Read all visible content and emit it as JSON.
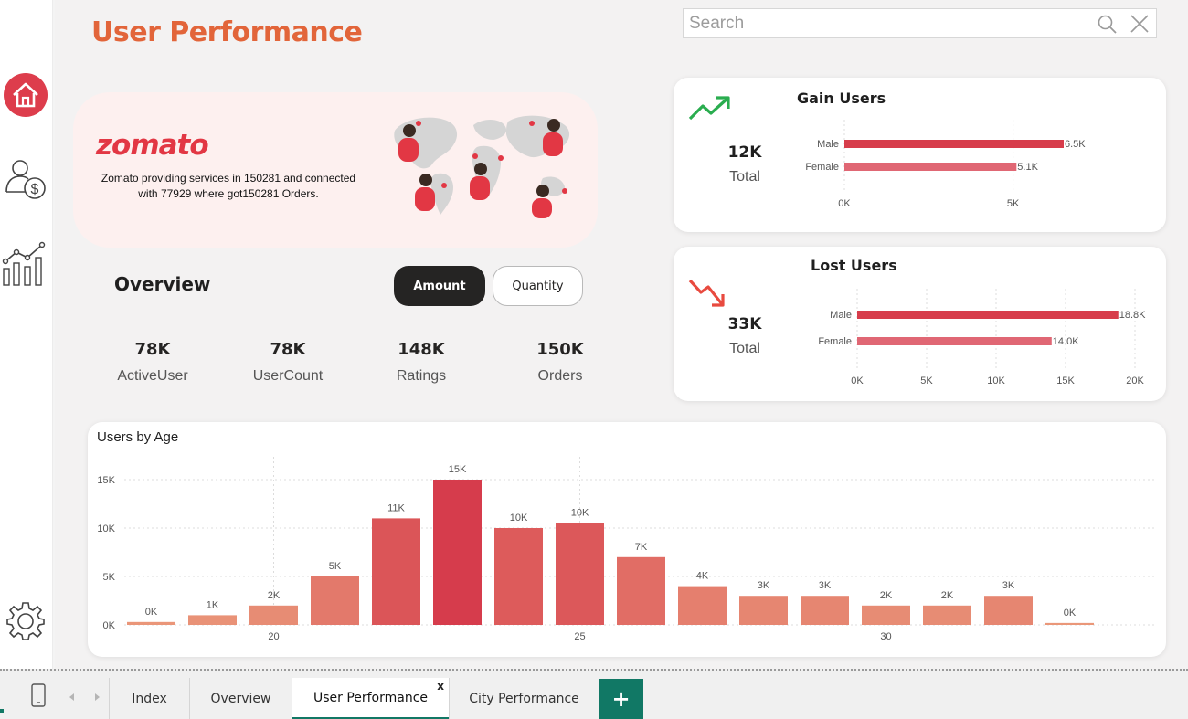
{
  "page": {
    "title": "User Performance"
  },
  "search": {
    "placeholder": "Search",
    "value": ""
  },
  "sidebar": {
    "items": [
      {
        "name": "home",
        "icon": "home-icon"
      },
      {
        "name": "user-finance",
        "icon": "user-dollar-icon"
      },
      {
        "name": "analytics",
        "icon": "chart-analytics-icon"
      },
      {
        "name": "settings",
        "icon": "gear-icon"
      }
    ]
  },
  "banner": {
    "logo": "zomato",
    "text": "Zomato providing services in 150281 and connected with 77929 where got150281 Orders."
  },
  "overview": {
    "title": "Overview",
    "toggle": {
      "amount": "Amount",
      "quantity": "Quantity",
      "selected": "Amount"
    },
    "kpis": [
      {
        "value": "78K",
        "label": "ActiveUser"
      },
      {
        "value": "78K",
        "label": "UserCount"
      },
      {
        "value": "148K",
        "label": "Ratings"
      },
      {
        "value": "150K",
        "label": "Orders"
      }
    ]
  },
  "gain_users": {
    "title": "Gain Users",
    "total_value": "12K",
    "total_label": "Total",
    "trend_icon": "trend-up-icon"
  },
  "lost_users": {
    "title": "Lost Users",
    "total_value": "33K",
    "total_label": "Total",
    "trend_icon": "trend-down-icon"
  },
  "colors": {
    "accent": "#e2653a",
    "brand": "#e23744",
    "trend_up": "#2aad4f",
    "trend_down": "#e84a3f",
    "tab_active": "#117865"
  },
  "chart_data": [
    {
      "type": "bar",
      "orientation": "horizontal",
      "categories": [
        "Male",
        "Female"
      ],
      "values": [
        6.5,
        5.1
      ],
      "data_labels": [
        "6.5K",
        "5.1K"
      ],
      "xlim": [
        0,
        6.5
      ],
      "xticks": [
        "0K",
        "5K"
      ],
      "bar_colors": [
        "#d73d4b",
        "#e06774"
      ],
      "grid": true
    },
    {
      "type": "bar",
      "orientation": "horizontal",
      "categories": [
        "Male",
        "Female"
      ],
      "values": [
        18.8,
        14.0
      ],
      "data_labels": [
        "18.8K",
        "14.0K"
      ],
      "xlim": [
        0,
        20
      ],
      "xticks": [
        "0K",
        "5K",
        "10K",
        "15K",
        "20K"
      ],
      "bar_colors": [
        "#d73d4b",
        "#e06774"
      ],
      "grid": true
    },
    {
      "type": "bar",
      "title": "Users by Age",
      "x": [
        18,
        19,
        20,
        21,
        22,
        23,
        24,
        25,
        26,
        27,
        28,
        29,
        30,
        31,
        32,
        33
      ],
      "values": [
        0.3,
        1,
        2,
        5,
        11,
        15,
        10,
        10.5,
        7,
        4,
        3,
        3,
        2,
        2,
        3,
        0.2
      ],
      "data_labels": [
        "0K",
        "1K",
        "2K",
        "5K",
        "11K",
        "15K",
        "10K",
        "10K",
        "7K",
        "4K",
        "3K",
        "3K",
        "2K",
        "2K",
        "3K",
        "0K"
      ],
      "ylim": [
        0,
        15
      ],
      "yticks": [
        "0K",
        "5K",
        "10K",
        "15K"
      ],
      "xticks": [
        "20",
        "25",
        "30"
      ],
      "grid": true
    }
  ],
  "tabs": {
    "index": "Index",
    "overview": "Overview",
    "user_performance": "User Performance",
    "city_performance": "City Performance",
    "close": "x",
    "add": "+",
    "active": "User Performance"
  }
}
